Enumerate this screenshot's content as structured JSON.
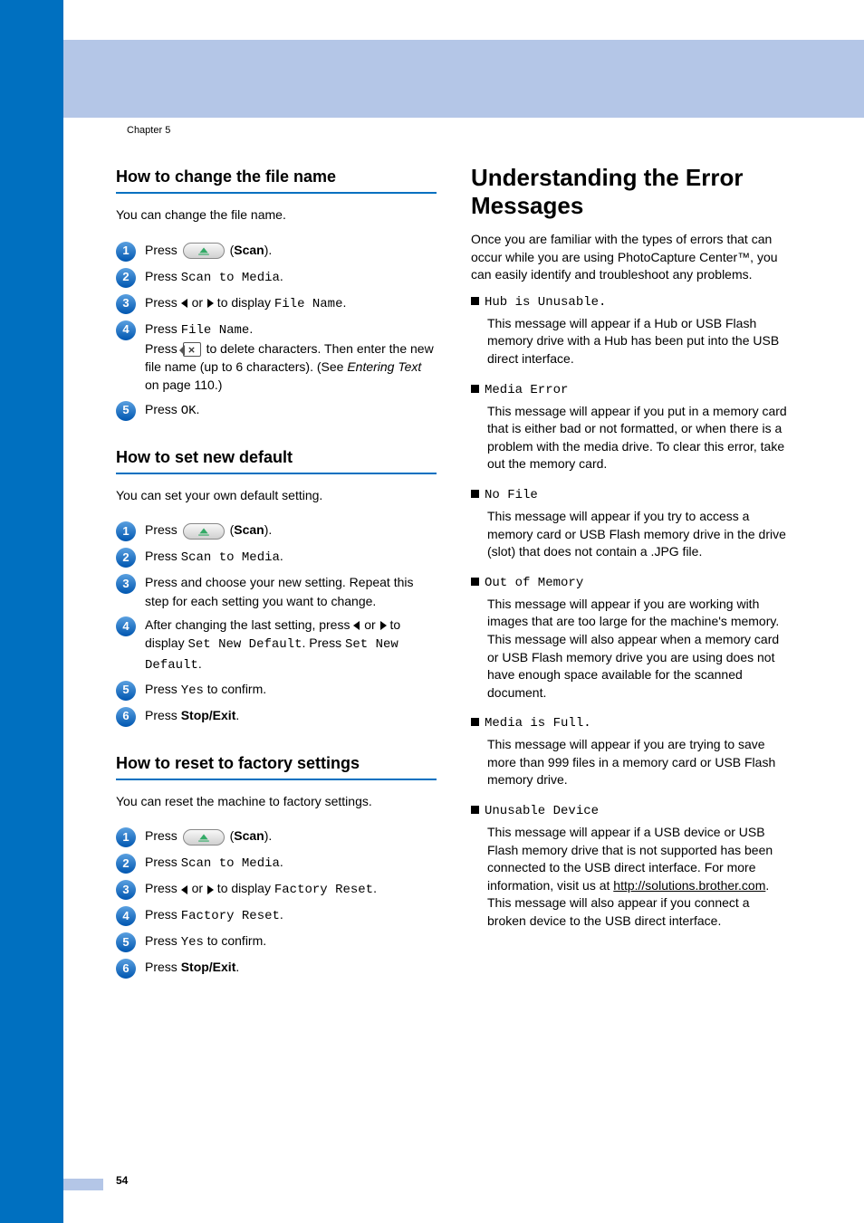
{
  "chapter_label": "Chapter 5",
  "page_number": "54",
  "left": {
    "scan_label": "Scan",
    "s1": {
      "title": "How to change the file name",
      "intro": "You can change the file name.",
      "press": "Press ",
      "paren_close": ").",
      "step2_a": "Press ",
      "step2_b": "Scan to Media",
      "step2_c": ".",
      "step3_a": "Press ",
      "step3_b": " or ",
      "step3_c": " to display ",
      "step3_d": "File Name",
      "step3_e": ".",
      "step4_a": "Press ",
      "step4_b": "File Name",
      "step4_c": ".",
      "step4_d": "Press ",
      "step4_e": " to delete characters. Then enter the new file name (up to 6 characters). (See ",
      "step4_f": "Entering Text",
      "step4_g": " on page 110.)",
      "step5_a": "Press ",
      "step5_b": "OK",
      "step5_c": "."
    },
    "s2": {
      "title": "How to set new default",
      "intro": "You can set your own default setting.",
      "press": "Press ",
      "paren_close": ").",
      "step2_a": "Press ",
      "step2_b": "Scan to Media",
      "step2_c": ".",
      "step3": "Press and choose your new setting. Repeat this step for each setting you want to change.",
      "step4_a": "After changing the last setting, press ",
      "step4_b": " or ",
      "step4_c": " to display ",
      "step4_d": "Set New Default",
      "step4_e": ". Press ",
      "step4_f": "Set New Default",
      "step4_g": ".",
      "step5_a": "Press ",
      "step5_b": "Yes",
      "step5_c": " to confirm.",
      "step6_a": "Press ",
      "step6_b": "Stop/Exit",
      "step6_c": "."
    },
    "s3": {
      "title": "How to reset to factory settings",
      "intro": "You can reset the machine to factory settings.",
      "press": "Press ",
      "paren_close": ").",
      "step2_a": "Press ",
      "step2_b": "Scan to Media",
      "step2_c": ".",
      "step3_a": "Press ",
      "step3_b": " or ",
      "step3_c": " to display ",
      "step3_d": "Factory Reset",
      "step3_e": ".",
      "step4_a": "Press ",
      "step4_b": "Factory Reset",
      "step4_c": ".",
      "step5_a": "Press ",
      "step5_b": "Yes",
      "step5_c": " to confirm.",
      "step6_a": "Press ",
      "step6_b": "Stop/Exit",
      "step6_c": "."
    }
  },
  "right": {
    "title": "Understanding the Error Messages",
    "intro": "Once you are familiar with the types of errors that can occur while you are using PhotoCapture Center™, you can easily identify and troubleshoot any problems.",
    "errors": [
      {
        "code": "Hub is Unusable.",
        "text": "This message will appear if a Hub or USB Flash memory drive with a Hub has been put into the USB direct interface."
      },
      {
        "code": "Media Error",
        "text": "This message will appear if you put in a memory card that is either bad or not formatted, or when there is a problem with the media drive. To clear this error, take out the memory card."
      },
      {
        "code": "No File",
        "text": "This message will appear if you try to access a memory card or USB Flash memory drive in the drive (slot) that does not contain a .JPG file."
      },
      {
        "code": "Out of Memory",
        "text": "This message will appear if you are working with images that are too large for the machine's memory. This message will also appear when a memory card or USB Flash memory drive you are using does not have enough space available for the scanned document."
      },
      {
        "code": "Media is Full.",
        "text": "This message will appear if you are trying to save more than 999 files in a memory card or USB Flash memory drive."
      },
      {
        "code": "Unusable Device",
        "text_a": "This message will appear if a USB device or USB Flash memory drive that is not supported has been connected to the USB direct interface. For more information, visit us at ",
        "link": "http://solutions.brother.com",
        "text_b": ". This message will also appear if you connect a broken device to the USB direct interface."
      }
    ]
  }
}
